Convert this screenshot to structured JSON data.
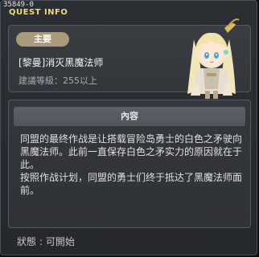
{
  "window": {
    "quest_id": "35849-0",
    "title": "QUEST INFO"
  },
  "header": {
    "type_badge": "主要",
    "quest_name": "[黎曼]消灭黑魔法师",
    "level_requirement": "建議等級：255以上",
    "npc_icon": "npc-portrait-icon"
  },
  "content": {
    "header_label": "內容",
    "description": "同盟的最终作战是让搭载冒险岛勇士的白色之矛驶向黑魔法师。此前一直保存白色之矛实力的原因就在于此。\n按照作战计划，同盟的勇士们终于抵达了黑魔法师面前。"
  },
  "status": {
    "label": "狀態",
    "value": "可開始"
  },
  "colors": {
    "title": "#f0d97a",
    "badge": "#a79b7b",
    "panel": "#33363b"
  }
}
